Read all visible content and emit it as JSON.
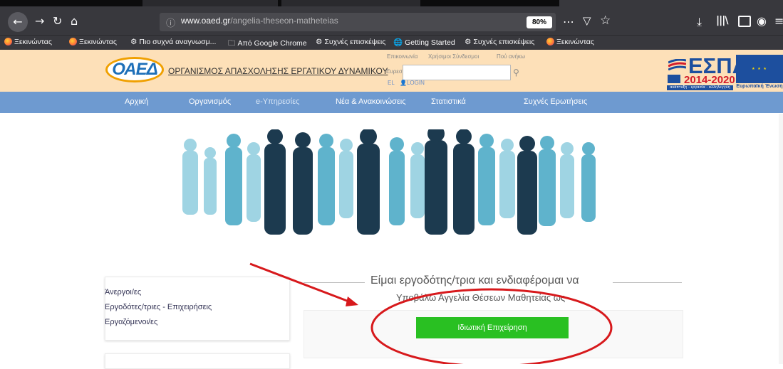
{
  "browser": {
    "url_host": "www.oaed.gr",
    "url_path": "/angelia-theseon-matheteias",
    "zoom": "80%",
    "bookmarks": [
      "Ξεκινώντας",
      "Ξεκινώντας",
      "Πιο συχνά αναγνωσμ...",
      "Από Google Chrome",
      "Συχνές επισκέψεις",
      "Getting Started",
      "Συχνές επισκέψεις",
      "Ξεκινώντας"
    ]
  },
  "header": {
    "logo_text": "ΟΑΕΔ",
    "org_name": "ΟΡΓΑΝΙΣΜΟΣ ΑΠΑΣΧΟΛΗΣΗΣ ΕΡΓΑΤΙΚΟΥ ΔΥΝΑΜΙΚΟΥ",
    "top_links": [
      "Επικοινωνία",
      "Χρήσιμοι Σύνδεσμοι",
      "Πού ανήκω"
    ],
    "search_label": "Ευρεσ",
    "lang": "EL",
    "login": "LOGIN",
    "espa_text": "ΕΣΠΑ",
    "espa_years": "2014-2020",
    "espa_sub": "ανάπτυξη - εργασία - αλληλεγγύη",
    "eu_label": "Ευρωπαϊκή Ένωση"
  },
  "nav": [
    "Αρχική",
    "Οργανισμός",
    "e-Υπηρεσίες",
    "Νέα & Ανακοινώσεις",
    "Στατιστικά",
    "Συχνές Ερωτήσεις"
  ],
  "sidebar": [
    "Άνεργοι/ες",
    "Εργοδότες/τριες - Επιχειρήσεις",
    "Εργαζόμενοι/ες"
  ],
  "main": {
    "heading": "Είμαι εργοδότης/τρια και ενδιαφέρομαι να",
    "subheading": "Υποβάλω Αγγελία Θέσεων Μαθητείας ως",
    "button": "Ιδιωτική Επιχείρηση"
  },
  "colors": {
    "nav_bg": "#6e9ad0",
    "header_bg": "#fde0b8",
    "button_green": "#29c022",
    "annotation_red": "#d7191c"
  }
}
